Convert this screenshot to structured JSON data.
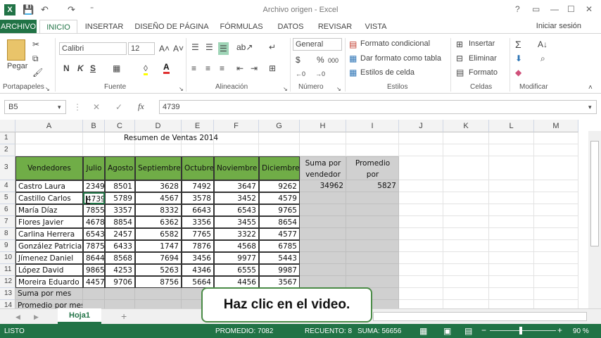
{
  "window": {
    "title": "Archivo origen - Excel",
    "help": "?",
    "restore": "▭",
    "minimize": "—",
    "maximize": "☐",
    "close": "✕"
  },
  "qat": {
    "save": "💾",
    "undo": "↶",
    "redo": "↷",
    "more": "⁼"
  },
  "tabs": [
    "ARCHIVO",
    "INICIO",
    "INSERTAR",
    "DISEÑO DE PÁGINA",
    "FÓRMULAS",
    "DATOS",
    "REVISAR",
    "VISTA"
  ],
  "signin": "Iniciar sesión",
  "ribbon": {
    "groups": [
      "Portapapeles",
      "Fuente",
      "Alineación",
      "Número",
      "Estilos",
      "Celdas",
      "Modificar"
    ],
    "paste": "Pegar",
    "font_name": "Calibri",
    "font_size": "12",
    "grow": "A˄",
    "shrink": "A˅",
    "bold": "N",
    "italic": "K",
    "underline": "S",
    "number_format": "General",
    "currency": "$",
    "percent": "%",
    "thousands": "000",
    "cond_format": "Formato condicional",
    "table_format": "Dar formato como tabla",
    "cell_styles": "Estilos de celda",
    "insert": "Insertar",
    "delete": "Eliminar",
    "format": "Formato",
    "launcher": "↘"
  },
  "formula": {
    "namebox": "B5",
    "cancel": "✕",
    "enter": "✓",
    "fx": "fx",
    "value": "4739"
  },
  "columns": [
    "A",
    "B",
    "C",
    "D",
    "E",
    "F",
    "G",
    "H",
    "I",
    "J",
    "K",
    "L",
    "M"
  ],
  "rows": [
    "1",
    "2",
    "3",
    "4",
    "5",
    "6",
    "7",
    "8",
    "9",
    "10",
    "11",
    "12",
    "13",
    "14"
  ],
  "sheet": {
    "title": "Resumen de Ventas 2014",
    "headers": [
      "Vendedores",
      "Julio",
      "Agosto",
      "Septiembre",
      "Octubre",
      "Noviembre",
      "Diciembre"
    ],
    "sum_header": "Suma por vendedor",
    "avg_header": "Promedio por vendedor",
    "data": [
      [
        "Castro Laura",
        "2349",
        "8501",
        "3628",
        "7492",
        "3647",
        "9262"
      ],
      [
        "Castillo Carlos",
        "4739",
        "5789",
        "4567",
        "3578",
        "3452",
        "4579"
      ],
      [
        "María Díaz",
        "7855",
        "3357",
        "8332",
        "6643",
        "6543",
        "9765"
      ],
      [
        "Flores Javier",
        "4678",
        "8854",
        "6362",
        "3356",
        "3455",
        "8654"
      ],
      [
        "Carlina Herrera",
        "6543",
        "2457",
        "6582",
        "7765",
        "3322",
        "4577"
      ],
      [
        "González Patricia",
        "7875",
        "6433",
        "1747",
        "7876",
        "4568",
        "6785"
      ],
      [
        "Jímenez Daniel",
        "8644",
        "8568",
        "7694",
        "3456",
        "9977",
        "5443"
      ],
      [
        "López David",
        "9865",
        "4253",
        "5263",
        "4346",
        "6555",
        "9987"
      ],
      [
        "Moreira Eduardo",
        "4457",
        "9706",
        "8756",
        "5664",
        "4456",
        "3567"
      ]
    ],
    "sum_value": "34962",
    "avg_value": "5827",
    "row13_label": "Suma por mes",
    "row14_label": "Promedio por mes"
  },
  "sheet_tab": "Hoja1",
  "add_sheet": "+",
  "status": {
    "ready": "LISTO",
    "average": "PROMEDIO: 7082",
    "count": "RECUENTO: 8",
    "sum": "SUMA: 56656",
    "zoom": "90 %",
    "zoom_minus": "−",
    "zoom_plus": "+"
  },
  "callout": "Haz clic en el video."
}
